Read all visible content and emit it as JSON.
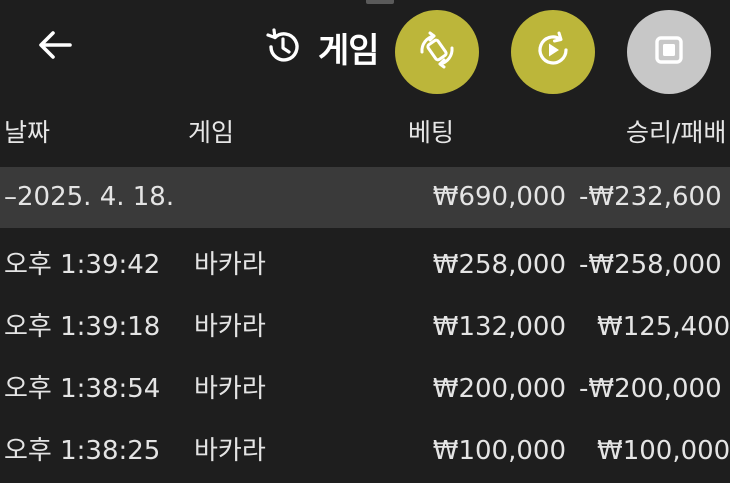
{
  "header": {
    "title": "게임",
    "back_icon": "arrow-left-icon",
    "title_icon": "history-icon"
  },
  "fabs": [
    {
      "name": "rotate-action",
      "icon": "rotate-icon",
      "color": "#bcb63a"
    },
    {
      "name": "autoplay-action",
      "icon": "replay-play-icon",
      "color": "#bcb63a"
    },
    {
      "name": "stop-action",
      "icon": "stop-square-icon",
      "color": "#c7c7c7"
    }
  ],
  "table": {
    "columns": [
      "날짜",
      "게임",
      "베팅",
      "승리/패배"
    ],
    "summary": {
      "date": "–2025. 4. 18.",
      "bet": "₩690,000",
      "result": "-₩232,600"
    },
    "rows": [
      {
        "time": "오후 1:39:42",
        "game": "바카라",
        "bet": "₩258,000",
        "result": "-₩258,000"
      },
      {
        "time": "오후 1:39:18",
        "game": "바카라",
        "bet": "₩132,000",
        "result": "₩125,400"
      },
      {
        "time": "오후 1:38:54",
        "game": "바카라",
        "bet": "₩200,000",
        "result": "-₩200,000"
      },
      {
        "time": "오후 1:38:25",
        "game": "바카라",
        "bet": "₩100,000",
        "result": "₩100,000"
      }
    ]
  },
  "colors": {
    "background": "#1e1e1e",
    "summary_row": "#3a3a3a",
    "accent": "#bcb63a",
    "stop": "#c7c7c7"
  }
}
